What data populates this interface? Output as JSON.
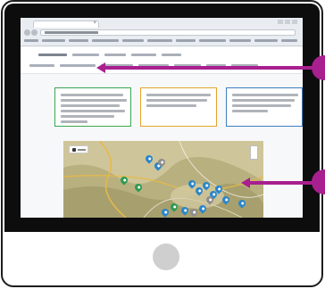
{
  "browser": {
    "tab_title": "",
    "url": ""
  },
  "site_nav": {
    "primary_items": [
      "",
      "",
      "",
      "",
      ""
    ],
    "secondary_items": [
      "",
      "",
      "",
      "",
      "",
      "",
      ""
    ]
  },
  "cards": [
    {
      "text": "",
      "accent": "#39a852"
    },
    {
      "text": "",
      "accent": "#e3a52b"
    },
    {
      "text": "",
      "accent": "#3d7fc1"
    }
  ],
  "map": {
    "legend": "",
    "pin_colors": {
      "blue": "#2b86c9",
      "green": "#2e9a52",
      "gray": "#8d8d8d"
    }
  },
  "annotations": {
    "color": "#a81f8f",
    "callouts": [
      "",
      ""
    ]
  }
}
